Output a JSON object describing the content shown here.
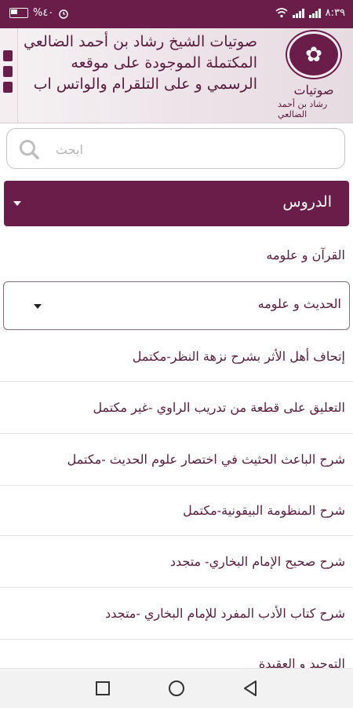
{
  "status_bar": {
    "battery_text": "%٤٠",
    "time": "٨:٣٩",
    "icons": [
      "battery-icon",
      "alarm-icon",
      "wifi-icon",
      "signal-icon",
      "signal-icon"
    ]
  },
  "header": {
    "description": "صوتيات الشيخ رشاد بن أحمد الضالعي المكتملة الموجودة على موقعه الرسمي و على التلقرام والواتس اب",
    "logo_word": "صوتيات",
    "logo_name": "رشاد بن أحمد الضالعي"
  },
  "search": {
    "placeholder": "ابحث"
  },
  "section": {
    "title": "الدروس"
  },
  "categories": [
    {
      "label": "القرآن و علومه"
    }
  ],
  "subsection": {
    "title": "الحديث و علومه"
  },
  "lessons": [
    {
      "label": "إتحاف أهل الأثر بشرح نزهة النظر-مكتمل"
    },
    {
      "label": "التعليق على قطعة من تدريب الراوي -غير مكتمل"
    },
    {
      "label": "شرح الباعث الحثيث في اختصار علوم الحديث -مكتمل"
    },
    {
      "label": "شرح المنظومة البيقونية-مكتمل"
    },
    {
      "label": "شرح صحيح الإمام البخاري- متجدد"
    },
    {
      "label": "شرح كتاب الأدب المفرد للإمام البخاري -متجدد"
    },
    {
      "label": "التوحيد و العقيدة"
    }
  ],
  "colors": {
    "primary": "#6b1d4a",
    "text": "#5a1a3e"
  }
}
